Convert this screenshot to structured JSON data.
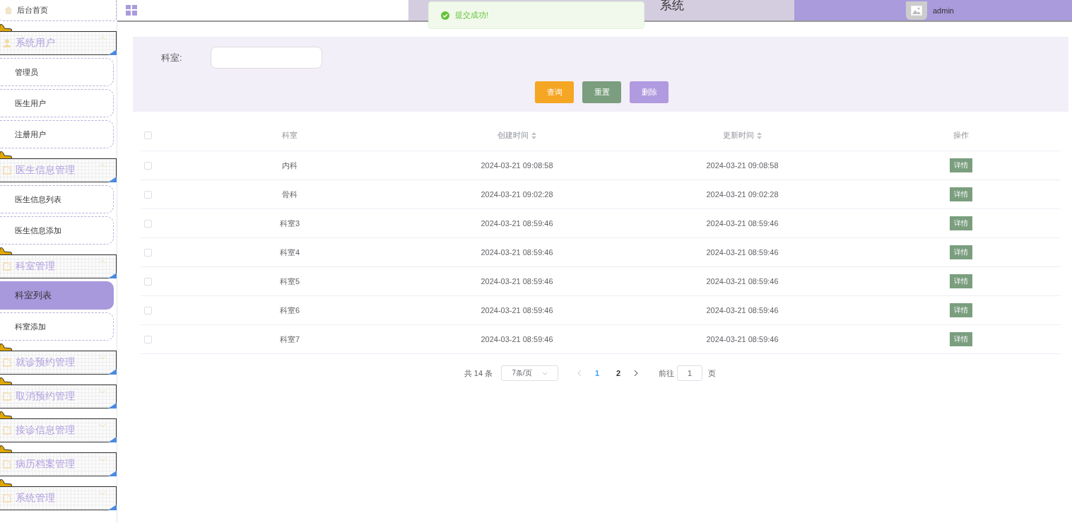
{
  "sidebar": {
    "home": {
      "label": "后台首页"
    },
    "groups": [
      {
        "label": "系统用户",
        "expanded": true,
        "children": [
          {
            "label": "管理员",
            "selected": false
          },
          {
            "label": "医生用户",
            "selected": false
          },
          {
            "label": "注册用户",
            "selected": false
          }
        ]
      },
      {
        "label": "医生信息管理",
        "expanded": true,
        "children": [
          {
            "label": "医生信息列表",
            "selected": false
          },
          {
            "label": "医生信息添加",
            "selected": false
          }
        ]
      },
      {
        "label": "科室管理",
        "expanded": true,
        "children": [
          {
            "label": "科室列表",
            "selected": true
          },
          {
            "label": "科室添加",
            "selected": false
          }
        ]
      },
      {
        "label": "就诊预约管理",
        "expanded": false
      },
      {
        "label": "取消预约管理",
        "expanded": false
      },
      {
        "label": "接诊信息管理",
        "expanded": false
      },
      {
        "label": "病历档案管理",
        "expanded": false
      },
      {
        "label": "系统管理",
        "expanded": false
      }
    ]
  },
  "header": {
    "title": "系统",
    "user": "admin"
  },
  "toast": {
    "message": "提交成功!"
  },
  "search": {
    "label": "科室:",
    "buttons": [
      {
        "label": "查询",
        "kind": "query"
      },
      {
        "label": "重置",
        "kind": "reset"
      },
      {
        "label": "删除",
        "kind": "delete"
      }
    ]
  },
  "table": {
    "header_checked": false,
    "columns": [
      {
        "label": "科室",
        "sortable": false
      },
      {
        "label": "创建时间",
        "sortable": true
      },
      {
        "label": "更新时间",
        "sortable": true
      },
      {
        "label": "操作",
        "sortable": false
      }
    ],
    "rows": [
      {
        "checked": false,
        "dept": "内科",
        "created": "2024-03-21 09:08:58",
        "updated": "2024-03-21 09:08:58",
        "action": "详情"
      },
      {
        "checked": false,
        "dept": "骨科",
        "created": "2024-03-21 09:02:28",
        "updated": "2024-03-21 09:02:28",
        "action": "详情"
      },
      {
        "checked": false,
        "dept": "科室3",
        "created": "2024-03-21 08:59:46",
        "updated": "2024-03-21 08:59:46",
        "action": "详情"
      },
      {
        "checked": false,
        "dept": "科室4",
        "created": "2024-03-21 08:59:46",
        "updated": "2024-03-21 08:59:46",
        "action": "详情"
      },
      {
        "checked": false,
        "dept": "科室5",
        "created": "2024-03-21 08:59:46",
        "updated": "2024-03-21 08:59:46",
        "action": "详情"
      },
      {
        "checked": false,
        "dept": "科室6",
        "created": "2024-03-21 08:59:46",
        "updated": "2024-03-21 08:59:46",
        "action": "详情"
      },
      {
        "checked": false,
        "dept": "科室7",
        "created": "2024-03-21 08:59:46",
        "updated": "2024-03-21 08:59:46",
        "action": "详情"
      }
    ]
  },
  "pagination": {
    "total": "共 14 条",
    "page_size": "7条/页",
    "pages": [
      {
        "label": "1",
        "selected": true
      },
      {
        "label": "2",
        "selected": false
      }
    ],
    "goto_label": "前往",
    "goto_value": "1",
    "goto_suffix": "页"
  }
}
